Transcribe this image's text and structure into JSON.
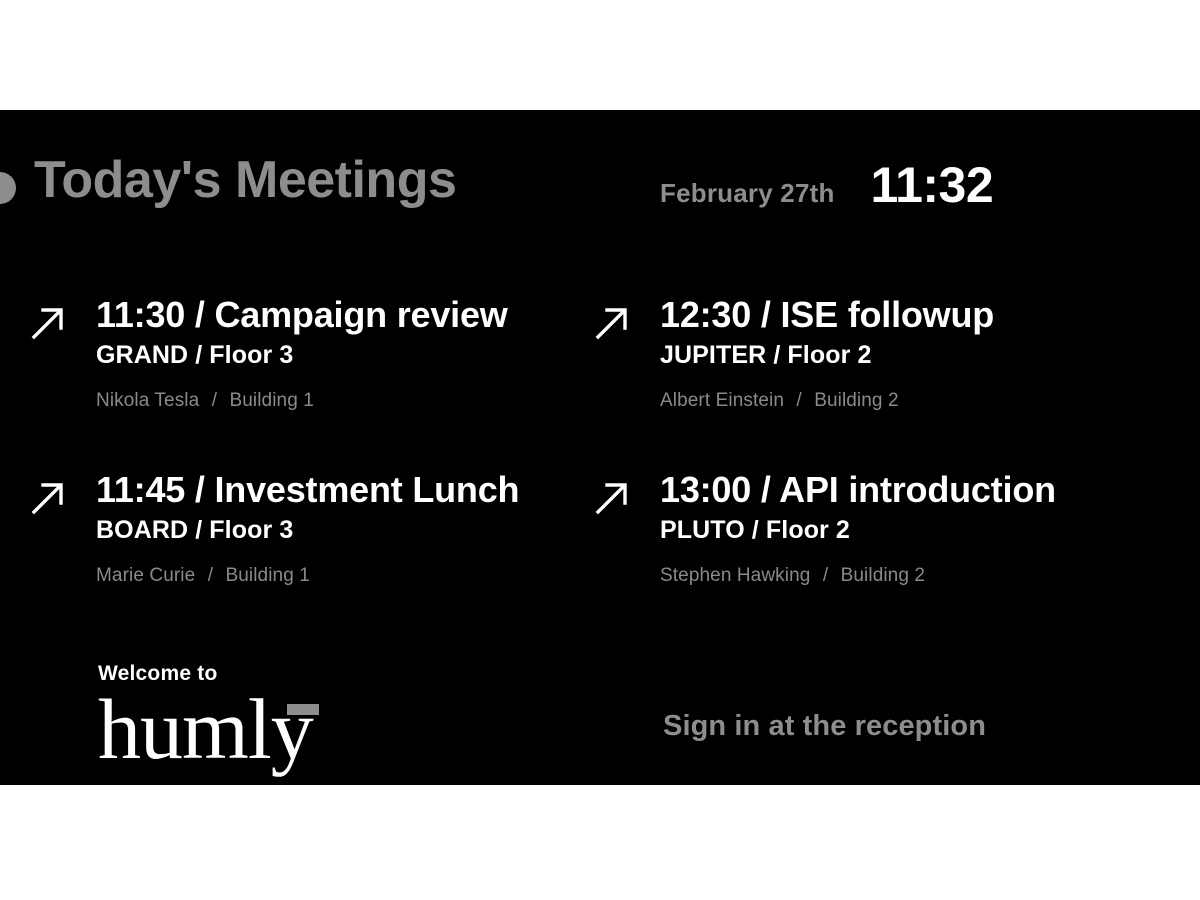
{
  "header": {
    "title": "Today's Meetings",
    "date": "February 27th",
    "time": "11:32",
    "status_dot_icon": "status-dot-icon",
    "title_color": "#8d8d8d",
    "time_color": "#ffffff"
  },
  "meetings": [
    {
      "arrow_icon": "arrow-up-right-icon",
      "title": "11:30 / Campaign review",
      "time": "11:30",
      "subject": "Campaign review",
      "room": "GRAND / Floor 3",
      "room_name": "GRAND",
      "floor": "Floor 3",
      "organizer": "Nikola Tesla",
      "separator": "/",
      "building": "Building 1"
    },
    {
      "arrow_icon": "arrow-up-right-icon",
      "title": "12:30 / ISE followup",
      "time": "12:30",
      "subject": "ISE followup",
      "room": "JUPITER / Floor 2",
      "room_name": "JUPITER",
      "floor": "Floor 2",
      "organizer": "Albert Einstein",
      "separator": "/",
      "building": "Building 2"
    },
    {
      "arrow_icon": "arrow-up-right-icon",
      "title": "11:45 / Investment Lunch",
      "time": "11:45",
      "subject": "Investment Lunch",
      "room": "BOARD / Floor 3",
      "room_name": "BOARD",
      "floor": "Floor 3",
      "organizer": "Marie Curie",
      "separator": "/",
      "building": "Building 1"
    },
    {
      "arrow_icon": "arrow-up-right-icon",
      "title": "13:00 / API introduction",
      "time": "13:00",
      "subject": "API introduction",
      "room": "PLUTO / Floor 2",
      "room_name": "PLUTO",
      "floor": "Floor 2",
      "organizer": "Stephen Hawking",
      "separator": "/",
      "building": "Building 2"
    }
  ],
  "footer": {
    "welcome_label": "Welcome to",
    "logo_text": "humly",
    "logo_trademark_icon": "trademark-dash-icon",
    "reception_note": "Sign in at the reception",
    "note_color": "#8d8d8d"
  },
  "theme": {
    "board_background": "#000000",
    "page_background": "#ffffff",
    "primary_text": "#ffffff",
    "muted_text": "#8a8a8a",
    "accent_gray": "#8d8d8d"
  }
}
